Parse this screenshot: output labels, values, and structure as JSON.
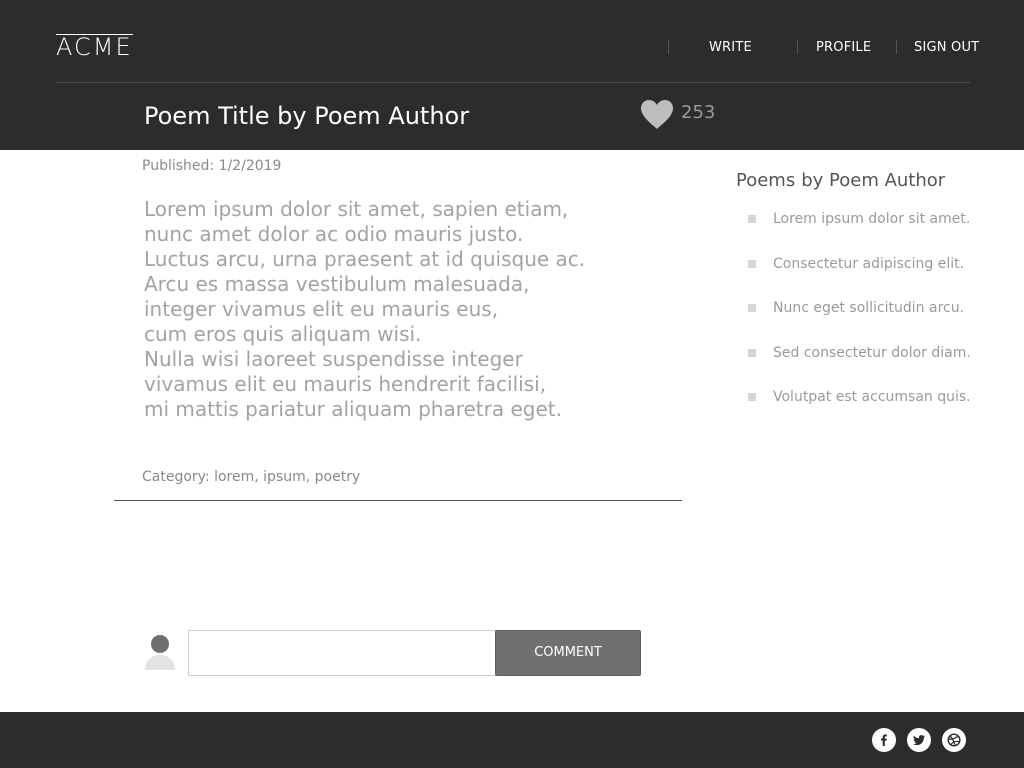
{
  "header": {
    "logo": "ACME",
    "nav": [
      {
        "label": "WRITE"
      },
      {
        "label": "PROFILE"
      },
      {
        "label": "SIGN OUT"
      }
    ],
    "poem_title": "Poem Title by Poem Author",
    "like_count": "253",
    "heart_icon": "heart-icon"
  },
  "poem": {
    "published": "Published: 1/2/2019",
    "lines": [
      "Lorem ipsum dolor sit amet, sapien etiam,",
      "nunc amet dolor ac odio mauris justo.",
      "Luctus arcu, urna praesent at id quisque ac.",
      "Arcu es massa vestibulum malesuada,",
      "integer vivamus elit eu mauris eus,",
      "cum eros quis aliquam wisi.",
      "Nulla wisi laoreet suspendisse integer",
      "vivamus elit eu mauris hendrerit facilisi,",
      "mi mattis pariatur aliquam pharetra eget."
    ],
    "category": "Category: lorem, ipsum, poetry"
  },
  "sidebar": {
    "title_prefix": "Poems",
    "title_suffix": "by Poem Author",
    "items": [
      {
        "label": "Lorem ipsum dolor sit amet."
      },
      {
        "label": "Consectetur adipiscing elit."
      },
      {
        "label": "Nunc eget sollicitudin arcu."
      },
      {
        "label": "Sed consectetur dolor diam."
      },
      {
        "label": "Volutpat est accumsan quis."
      }
    ]
  },
  "comment": {
    "input_value": "",
    "button_label": "COMMENT",
    "avatar_icon": "user-avatar-icon"
  },
  "footer": {
    "social": [
      "facebook-icon",
      "twitter-icon",
      "dribbble-icon"
    ]
  },
  "colors": {
    "header_bg": "#2c2c2c",
    "button_bg": "#707070",
    "text_muted": "#a3a3a3"
  }
}
